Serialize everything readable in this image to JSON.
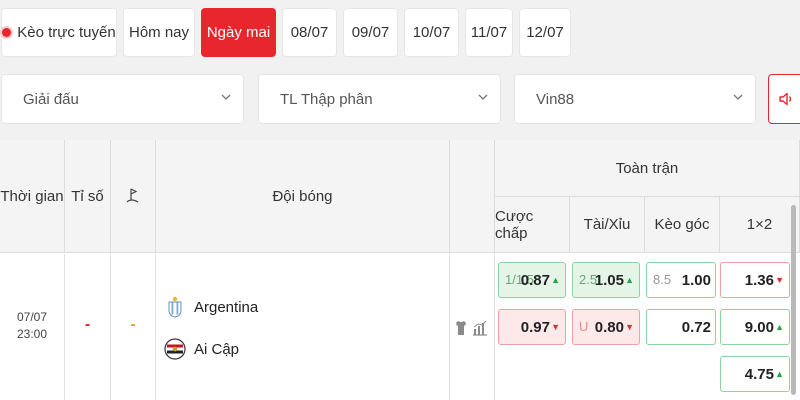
{
  "date_tabs": {
    "live": "Kèo trực tuyến",
    "today": "Hôm nay",
    "tomorrow": "Ngày mai",
    "d1": "08/07",
    "d2": "09/07",
    "d3": "10/07",
    "d4": "11/07",
    "d5": "12/07"
  },
  "filters": {
    "league": "Giải đấu",
    "odds_format": "TL Thập phân",
    "bookmaker": "Vin88"
  },
  "icons": {
    "sound": "speaker-icon",
    "dropdown": "chevron-down-icon",
    "corner": "corner-flag-icon",
    "jersey": "jersey-icon",
    "stats": "bar-chart-icon"
  },
  "colors": {
    "accent": "#e8262d",
    "odds_up": "#27a546",
    "odds_down": "#e8262d"
  },
  "table_header": {
    "time": "Thời gian",
    "score": "Tỉ số",
    "teams": "Đội bóng",
    "full_match": "Toàn trận",
    "handicap": "Cược chấp",
    "over_under": "Tài/Xỉu",
    "corner": "Kèo góc",
    "one_x_two": "1×2"
  },
  "match": {
    "date": "07/07",
    "time": "23:00",
    "score_home": "-",
    "score_corner": "-",
    "home_team": "Argentina",
    "away_team": "Ai Cập",
    "handicap_line": "1/1.5",
    "handicap_home": "0.87",
    "handicap_away": "0.97",
    "ou_line": "2.5",
    "ou_over": "1.05",
    "ou_under_label": "U",
    "ou_under": "0.80",
    "corner_line": "8.5",
    "corner_over": "1.00",
    "corner_under": "0.72",
    "x12_home": "1.36",
    "x12_away": "9.00",
    "x12_draw": "4.75"
  }
}
